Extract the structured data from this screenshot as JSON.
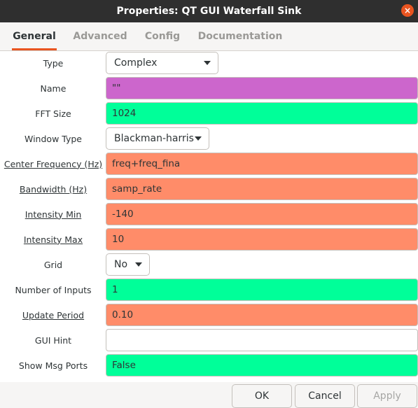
{
  "window": {
    "title": "Properties: QT GUI Waterfall Sink",
    "close_icon": "×"
  },
  "tabs": [
    {
      "label": "General",
      "active": true
    },
    {
      "label": "Advanced",
      "active": false
    },
    {
      "label": "Config",
      "active": false
    },
    {
      "label": "Documentation",
      "active": false
    }
  ],
  "fields": {
    "type": {
      "label": "Type",
      "value": "Complex"
    },
    "name": {
      "label": "Name",
      "value": "\"\""
    },
    "fft_size": {
      "label": "FFT Size",
      "value": "1024"
    },
    "window_type": {
      "label": "Window Type",
      "value": "Blackman-harris"
    },
    "center_frequency": {
      "label": "Center Frequency (Hz)",
      "value": "freq+freq_fina"
    },
    "bandwidth": {
      "label": "Bandwidth (Hz)",
      "value": "samp_rate"
    },
    "intensity_min": {
      "label": "Intensity Min",
      "value": "-140"
    },
    "intensity_max": {
      "label": "Intensity Max",
      "value": "10"
    },
    "grid": {
      "label": "Grid",
      "value": "No"
    },
    "number_of_inputs": {
      "label": "Number of Inputs",
      "value": "1"
    },
    "update_period": {
      "label": "Update Period",
      "value": "0.10"
    },
    "gui_hint": {
      "label": "GUI Hint",
      "value": ""
    },
    "show_msg_ports": {
      "label": "Show Msg Ports",
      "value": "False"
    }
  },
  "buttons": {
    "ok": "OK",
    "cancel": "Cancel",
    "apply": "Apply"
  },
  "colors": {
    "titlebar": "#2f2f2f",
    "accent": "#e95420",
    "field_green": "#00ff99",
    "field_orange": "#ff8c69",
    "field_purple": "#cc66cc"
  }
}
